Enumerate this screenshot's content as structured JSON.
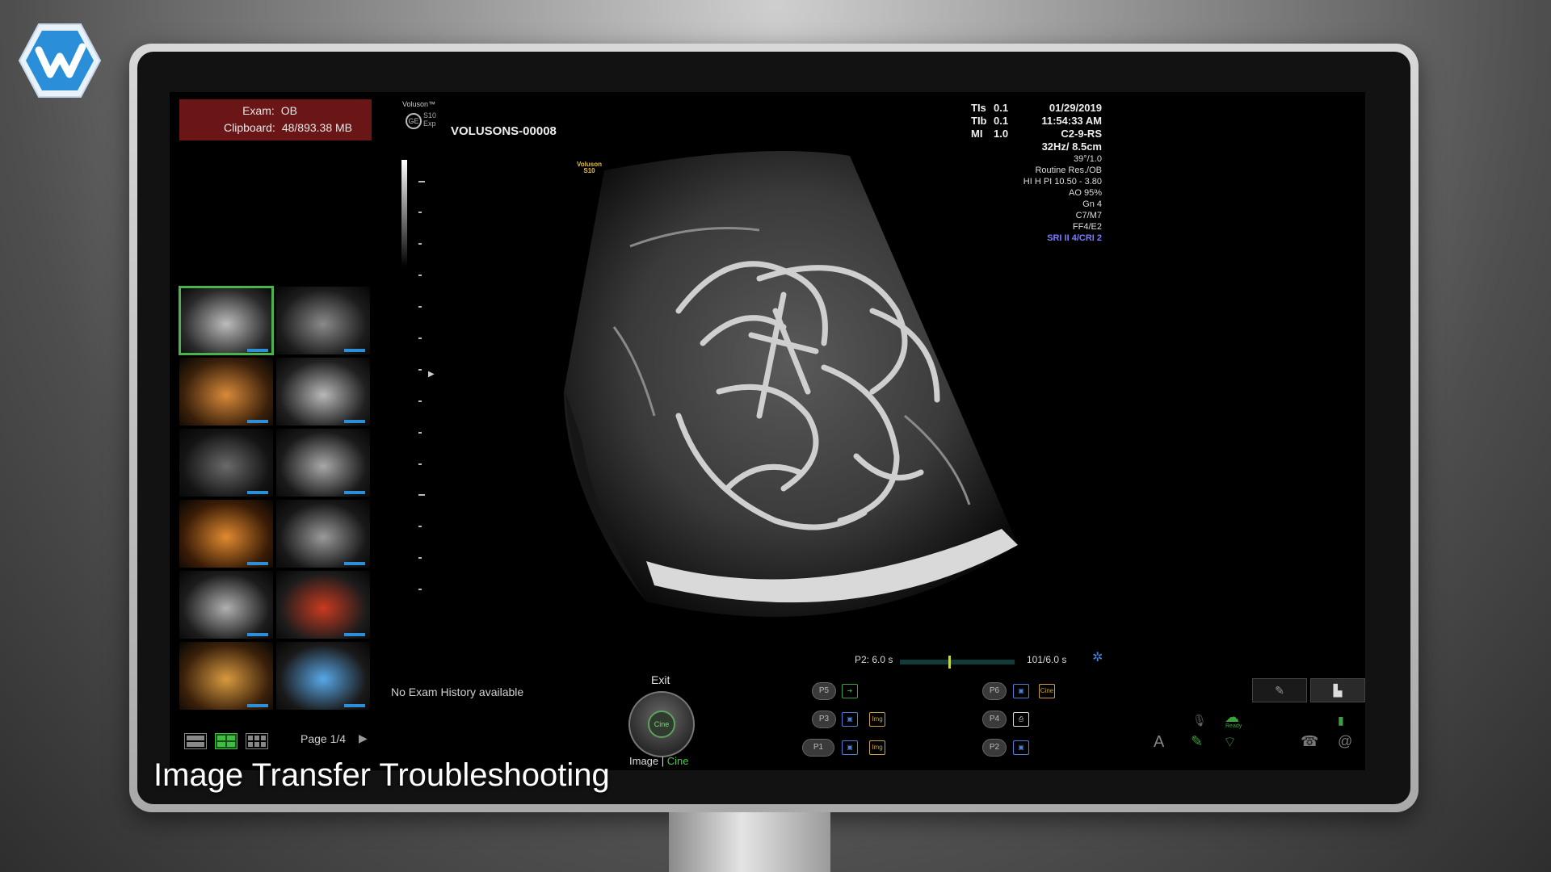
{
  "exam": {
    "exam_label": "Exam:",
    "exam_value": "OB",
    "clipboard_label": "Clipboard:",
    "clipboard_value": "48/893.38 MB"
  },
  "header": {
    "brand_line1": "Voluson™",
    "brand_line2": "S10",
    "brand_line3": "Exp",
    "volusion_badge_line1": "Voluson",
    "volusion_badge_line2": "S10",
    "patient_id": "VOLUSONS-00008"
  },
  "params": {
    "tis_label": "TIs",
    "tis_value": "0.1",
    "tib_label": "TIb",
    "tib_value": "0.1",
    "mi_label": "MI",
    "mi_value": "1.0",
    "date": "01/29/2019",
    "time": "11:54:33 AM",
    "probe": "C2-9-RS",
    "frame_depth": "32Hz/ 8.5cm",
    "lines": [
      "39°/1.0",
      "Routine Res./OB",
      "HI H PI 10.50 - 3.80",
      "AO 95%",
      "Gn  4",
      "C7/M7",
      "FF4/E2"
    ],
    "sri": "SRI II 4/CRI 2"
  },
  "cine": {
    "left_label": "P2:  6.0 s",
    "right_label": "101/6.0 s",
    "marker_fraction": 0.43,
    "settings_icon": "gear-icon"
  },
  "history_text": "No Exam History available",
  "knob": {
    "exit_label": "Exit",
    "inner_label": "Cine",
    "caption_image": "Image",
    "caption_sep": " | ",
    "caption_cine": "Cine"
  },
  "p_buttons": {
    "p5": "P5",
    "p3": "P3",
    "p1": "P1",
    "p6": "P6",
    "p4": "P4",
    "p2": "P2",
    "img_tag": "Img",
    "cine_tag": "Cine"
  },
  "pagination": {
    "page_label": "Page 1/4",
    "next_glyph": "▶"
  },
  "status": {
    "ready_label": "Ready"
  },
  "caption": "Image Transfer Troubleshooting",
  "colors": {
    "exam_bg": "#6a1616",
    "selected_thumb": "#4bb34b",
    "thumb_bar": "#2d8fd8",
    "sri": "#7b7bff",
    "cine_marker": "#c7d640"
  }
}
